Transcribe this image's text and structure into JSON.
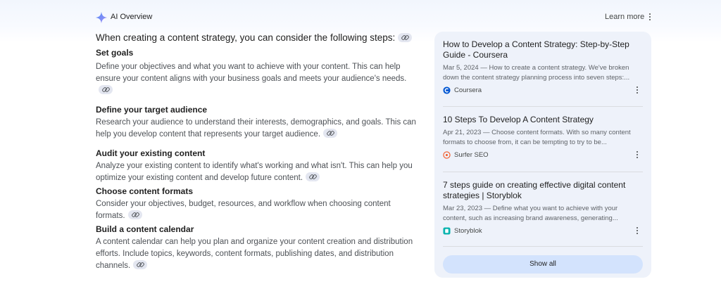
{
  "header": {
    "title": "AI Overview",
    "learn_more": "Learn more"
  },
  "main": {
    "intro": "When creating a content strategy, you can consider the following steps:",
    "steps": [
      {
        "title": "Set goals",
        "desc": "Define your objectives and what you want to achieve with your content. This can help ensure your content aligns with your business goals and meets your audience's needs."
      },
      {
        "title": "Define your target audience",
        "desc": "Research your audience to understand their interests, demographics, and goals. This can help you develop content that represents your target audience."
      },
      {
        "title": "Audit your existing content",
        "desc": "Analyze your existing content to identify what's working and what isn't. This can help you optimize your existing content and develop future content."
      },
      {
        "title": "Choose content formats",
        "desc": "Consider your objectives, budget, resources, and workflow when choosing content formats."
      },
      {
        "title": "Build a content calendar",
        "desc": "A content calendar can help you plan and organize your content creation and distribution efforts. Include topics, keywords, content formats, publishing dates, and distribution channels."
      }
    ]
  },
  "sources": {
    "items": [
      {
        "title": "How to Develop a Content Strategy: Step-by-Step Guide - Coursera",
        "snippet": "Mar 5, 2024 — How to create a content strategy. We've broken down the content strategy planning process into seven steps:...",
        "site": "Coursera",
        "favicon": "coursera-icon"
      },
      {
        "title": "10 Steps To Develop A Content Strategy",
        "snippet": "Apr 21, 2023 — Choose content formats. With so many content formats to choose from, it can be tempting to try to be...",
        "site": "Surfer SEO",
        "favicon": "surfer-seo-icon"
      },
      {
        "title": "7 steps guide on creating effective digital content strategies | Storyblok",
        "snippet": "Mar 23, 2023 — Define what you want to achieve with your content, such as increasing brand awareness, generating...",
        "site": "Storyblok",
        "favicon": "storyblok-icon"
      }
    ],
    "show_all": "Show all"
  },
  "colors": {
    "accent": "#d3e3fd",
    "panel_bg": "#eef2fa",
    "heading": "#1f1f1f",
    "body_text": "#4d5156"
  }
}
